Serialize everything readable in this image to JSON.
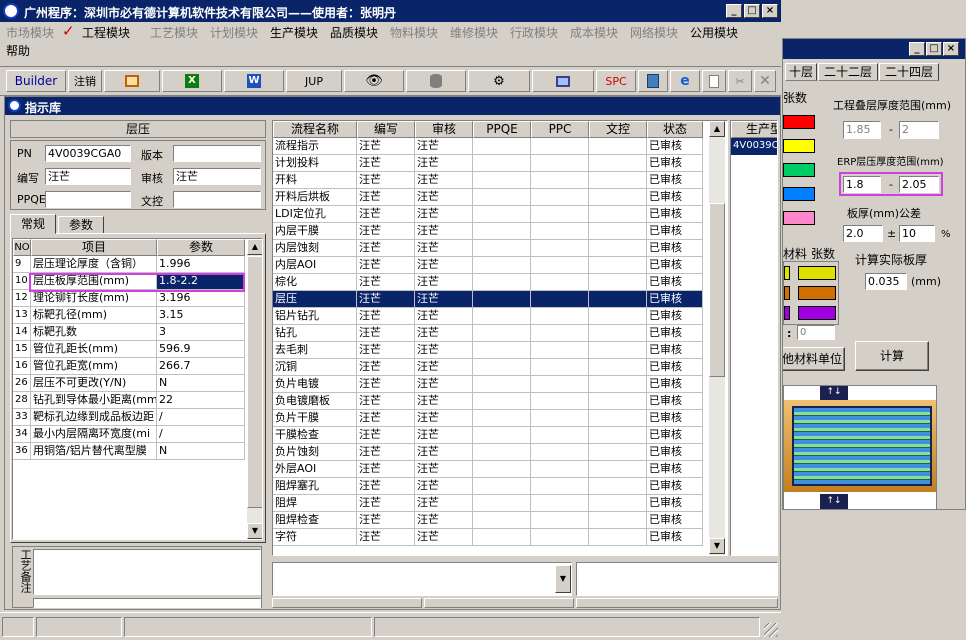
{
  "main_title": "广州程序：深圳市必有德计算机软件技术有限公司——使用者：张明丹",
  "menu": [
    {
      "label": "市场模块",
      "enabled": false
    },
    {
      "label": "工程模块",
      "enabled": true,
      "checked": true
    },
    {
      "label": "工艺模块",
      "enabled": false
    },
    {
      "label": "计划模块",
      "enabled": false
    },
    {
      "label": "生产模块",
      "enabled": true
    },
    {
      "label": "品质模块",
      "enabled": true
    },
    {
      "label": "物料模块",
      "enabled": false
    },
    {
      "label": "维修模块",
      "enabled": false
    },
    {
      "label": "行政模块",
      "enabled": false
    },
    {
      "label": "成本模块",
      "enabled": false
    },
    {
      "label": "网络模块",
      "enabled": false
    },
    {
      "label": "公用模块",
      "enabled": true
    }
  ],
  "menu_help": "帮助",
  "toolbar": {
    "builder": "Builder",
    "logout": "注销",
    "jup": "JUP",
    "spc": "SPC"
  },
  "child_title": "指示库",
  "panel_title": "层压",
  "fields": {
    "pn_label": "PN",
    "pn_value": "4V0039CGA0",
    "version_label": "版本",
    "version_value": "",
    "author_label": "编写",
    "author_value": "汪芒",
    "review_label": "审核",
    "review_value": "汪芒",
    "ppqe_label": "PPQE",
    "ppqe_value": "",
    "wenkong_label": "文控",
    "wenkong_value": ""
  },
  "tabs": [
    "常规",
    "参数"
  ],
  "param_headers": [
    "NO",
    "项目",
    "参数"
  ],
  "params": [
    {
      "no": "9",
      "item": "层压理论厚度（含铜）",
      "val": "1.996"
    },
    {
      "no": "10",
      "item": "层压板厚范围(mm)",
      "val": "1.8-2.2"
    },
    {
      "no": "12",
      "item": "理论铆钉长度(mm)",
      "val": "3.196"
    },
    {
      "no": "13",
      "item": "标靶孔径(mm)",
      "val": "3.15"
    },
    {
      "no": "14",
      "item": "标靶孔数",
      "val": "3"
    },
    {
      "no": "15",
      "item": "管位孔距长(mm)",
      "val": "596.9"
    },
    {
      "no": "16",
      "item": "管位孔距宽(mm)",
      "val": "266.7"
    },
    {
      "no": "26",
      "item": "层压不可更改(Y/N)",
      "val": "N"
    },
    {
      "no": "28",
      "item": "钻孔到导体最小距离(mm",
      "val": "22"
    },
    {
      "no": "33",
      "item": "靶标孔边缘到成品板边距",
      "val": "/"
    },
    {
      "no": "34",
      "item": "最小内层隔离环宽度(mi",
      "val": "/"
    },
    {
      "no": "36",
      "item": "用铜箔/铝片替代离型膜",
      "val": "N"
    }
  ],
  "remark_label": "工艺备注",
  "flow_headers": [
    "流程名称",
    "编写",
    "审核",
    "PPQE",
    "PPC",
    "文控",
    "状态"
  ],
  "flow": [
    [
      "流程指示",
      "汪芒",
      "汪芒",
      "",
      "",
      "",
      "已审核"
    ],
    [
      "计划投料",
      "汪芒",
      "汪芒",
      "",
      "",
      "",
      "已审核"
    ],
    [
      "开料",
      "汪芒",
      "汪芒",
      "",
      "",
      "",
      "已审核"
    ],
    [
      "开料后烘板",
      "汪芒",
      "汪芒",
      "",
      "",
      "",
      "已审核"
    ],
    [
      "LDI定位孔",
      "汪芒",
      "汪芒",
      "",
      "",
      "",
      "已审核"
    ],
    [
      "内层干膜",
      "汪芒",
      "汪芒",
      "",
      "",
      "",
      "已审核"
    ],
    [
      "内层蚀刻",
      "汪芒",
      "汪芒",
      "",
      "",
      "",
      "已审核"
    ],
    [
      "内层AOI",
      "汪芒",
      "汪芒",
      "",
      "",
      "",
      "已审核"
    ],
    [
      "棕化",
      "汪芒",
      "汪芒",
      "",
      "",
      "",
      "已审核"
    ],
    [
      "层压",
      "汪芒",
      "汪芒",
      "",
      "",
      "",
      "已审核"
    ],
    [
      "铝片钻孔",
      "汪芒",
      "汪芒",
      "",
      "",
      "",
      "已审核"
    ],
    [
      "钻孔",
      "汪芒",
      "汪芒",
      "",
      "",
      "",
      "已审核"
    ],
    [
      "去毛刺",
      "汪芒",
      "汪芒",
      "",
      "",
      "",
      "已审核"
    ],
    [
      "沉铜",
      "汪芒",
      "汪芒",
      "",
      "",
      "",
      "已审核"
    ],
    [
      "负片电镀",
      "汪芒",
      "汪芒",
      "",
      "",
      "",
      "已审核"
    ],
    [
      "负电镀磨板",
      "汪芒",
      "汪芒",
      "",
      "",
      "",
      "已审核"
    ],
    [
      "负片干膜",
      "汪芒",
      "汪芒",
      "",
      "",
      "",
      "已审核"
    ],
    [
      "干膜检查",
      "汪芒",
      "汪芒",
      "",
      "",
      "",
      "已审核"
    ],
    [
      "负片蚀刻",
      "汪芒",
      "汪芒",
      "",
      "",
      "",
      "已审核"
    ],
    [
      "外层AOI",
      "汪芒",
      "汪芒",
      "",
      "",
      "",
      "已审核"
    ],
    [
      "阻焊塞孔",
      "汪芒",
      "汪芒",
      "",
      "",
      "",
      "已审核"
    ],
    [
      "阻焊",
      "汪芒",
      "汪芒",
      "",
      "",
      "",
      "已审核"
    ],
    [
      "阻焊检查",
      "汪芒",
      "汪芒",
      "",
      "",
      "",
      "已审核"
    ],
    [
      "字符",
      "汪芒",
      "汪芒",
      "",
      "",
      "",
      "已审核"
    ]
  ],
  "side_header": "生产型",
  "side_value": "4V0039C",
  "right_win": {
    "tabs": [
      "十层",
      "二十二层",
      "二十四层"
    ],
    "colors_label": "张数",
    "eng_range_label": "工程叠层厚度范围(mm)",
    "eng_min": "1.85",
    "eng_max": "2",
    "erp_range_label": "ERP层压厚度范围(mm)",
    "erp_min": "1.8",
    "erp_max": "2.05",
    "thickness_label": "板厚(mm)公差",
    "thickness": "2.0",
    "plusminus": "±",
    "tolerance": "10",
    "pct": "%",
    "calc_label": "计算实际板厚",
    "calc_value": "0.035",
    "calc_unit": "(mm)",
    "material_label": "材料",
    "count_label": "张数",
    "colon": ":",
    "colon_value": "0",
    "unit_btn": "他材料单位",
    "calc_btn": "计算",
    "dash": "-"
  },
  "colors": [
    "#ff0000",
    "#ffff00",
    "#00cc66",
    "#0080ff",
    "#ff88cc"
  ]
}
